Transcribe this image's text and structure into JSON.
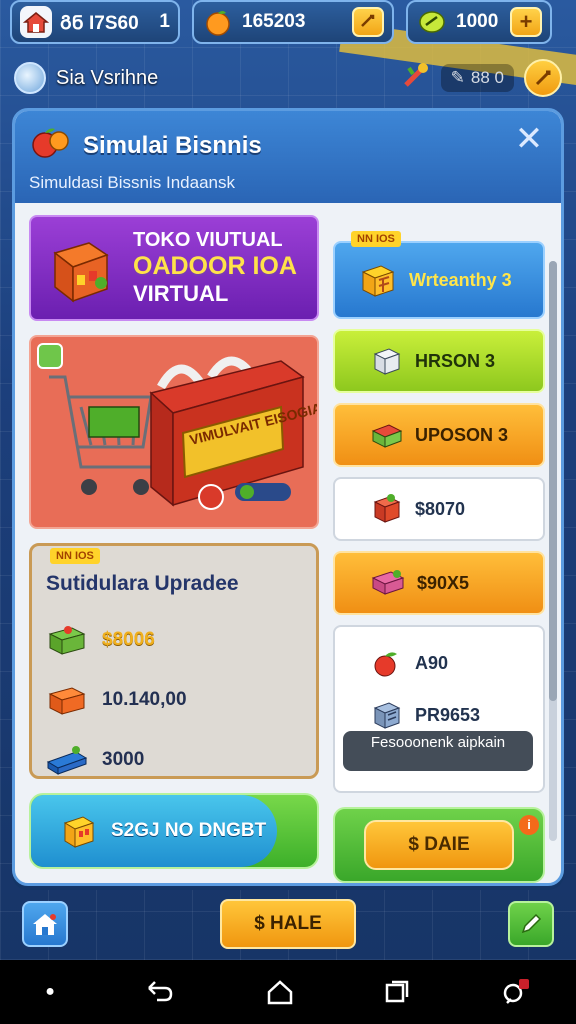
{
  "topbar": {
    "home_value": "ᲒᲜ I7S60",
    "home_badge": "1",
    "coins_value": "165203",
    "gems_value": "1000",
    "plus": "+"
  },
  "subbar": {
    "label": "Sia Vsrihne",
    "stat": "88 0"
  },
  "panel": {
    "title": "Simulai Bisnnis",
    "subtitle": "Simuldasi Bissnis Indaansk",
    "close": "✕"
  },
  "banner": {
    "line1": "TOKO VIUTUAL",
    "line2": "OADOOR IOA",
    "line3": "VIRTUAL"
  },
  "scene": {
    "sign": "VIMULVAIT EISOGIA"
  },
  "upgrade": {
    "tag": "NN IOS",
    "title": "Sutidulara Upradee",
    "rows": [
      {
        "value": "$8006",
        "icon": "produce-crate-icon"
      },
      {
        "value": "10.140,00",
        "icon": "orange-crate-icon"
      },
      {
        "value": "3000",
        "icon": "blue-tray-icon"
      }
    ]
  },
  "bottom_left": {
    "label": "S2GJ NO DNGBT"
  },
  "right": {
    "tag": "NN IOS",
    "blue": "Wrteanthy 3",
    "lime": "HRSON 3",
    "orange": "UPOSON 3",
    "white": "$8070",
    "orange2": "$90X5",
    "list": [
      {
        "value": "A90",
        "icon": "apple-icon"
      },
      {
        "value": "PR9653",
        "icon": "crate-icon"
      }
    ],
    "dark_btn": "Fesooonenk aipkain"
  },
  "bottom_right": {
    "label": "$ DAIE",
    "info": "i"
  },
  "game_nav": {
    "sale": "$ HALE"
  },
  "colors": {
    "panel_header": "#2a65b5",
    "banner": "#6b1fb0",
    "accent_gold": "#f0b01e",
    "accent_green": "#3db02a"
  }
}
